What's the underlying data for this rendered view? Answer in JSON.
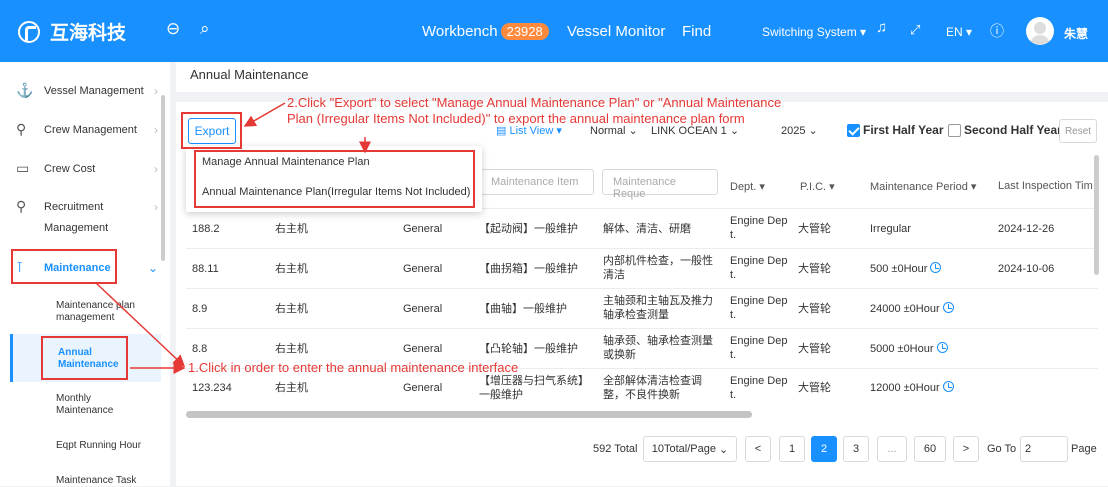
{
  "topbar": {
    "brand": "互海科技",
    "workbench": "Workbench",
    "workbench_count": "23928",
    "vessel_monitor": "Vessel Monitor",
    "find": "Find",
    "switching_system": "Switching System ▾",
    "lang": "EN ▾",
    "user": "朱慧"
  },
  "sidebar": {
    "items": [
      {
        "label": "Vessel Management"
      },
      {
        "label": "Crew Management"
      },
      {
        "label": "Crew Cost"
      },
      {
        "label": "Recruitment"
      },
      {
        "label2": "Management"
      },
      {
        "label": "Maintenance"
      }
    ],
    "sub": {
      "plan_mgmt_1": "Maintenance plan",
      "plan_mgmt_2": "management",
      "annual_1": "Annual",
      "annual_2": "Maintenance",
      "monthly_1": "Monthly",
      "monthly_2": "Maintenance",
      "eqpt": "Eqpt Running Hour",
      "task": "Maintenance Task"
    }
  },
  "page": {
    "title": "Annual Maintenance",
    "export": "Export",
    "list_view": "List View ▾",
    "normal": "Normal",
    "vessel": "LINK OCEAN 1",
    "year": "2025",
    "first_half": "First Half Year",
    "second_half": "Second Half Year",
    "reset": "Reset"
  },
  "dropdown": {
    "item1": "Manage Annual Maintenance Plan",
    "item2": "Annual Maintenance Plan(Irregular Items Not Included)"
  },
  "annotations": {
    "step2_line1": "2.Click \"Export\" to select \"Manage Annual Maintenance Plan\" or \"Annual Maintenance",
    "step2_line2": "Plan (Irregular Items Not Included)\" to export the annual maintenance plan form",
    "step1": "1.Click in order to enter the annual maintenance interface"
  },
  "table": {
    "filters": {
      "item": "Maintenance Item",
      "req": "Maintenance Reque"
    },
    "headers": {
      "dept": "Dept. ▾",
      "pic": "P.I.C. ▾",
      "period": "Maintenance Period ▾",
      "last": "Last Inspection Tim"
    },
    "rows": [
      {
        "code": "188.2",
        "equip": "右主机",
        "type": "General",
        "item": "【起动阀】一般维护",
        "req": "解体、清洁、研磨",
        "dept": "Engine Dep t.",
        "pic": "大管轮",
        "period": "Irregular",
        "last": "2024-12-26"
      },
      {
        "code": "88.11",
        "equip": "右主机",
        "type": "General",
        "item": "【曲拐箱】一般维护",
        "req": "内部机件检查，一般性清洁",
        "dept": "Engine Dep t.",
        "pic": "大管轮",
        "period": "500 ±0Hour",
        "last": "2024-10-06"
      },
      {
        "code": "8.9",
        "equip": "右主机",
        "type": "General",
        "item": "【曲轴】一般维护",
        "req": "主轴颈和主轴瓦及推力轴承检查测量",
        "dept": "Engine Dep t.",
        "pic": "大管轮",
        "period": "24000 ±0Hour",
        "last": ""
      },
      {
        "code": "8.8",
        "equip": "右主机",
        "type": "General",
        "item": "【凸轮轴】一般维护",
        "req": "轴承颈、轴承检查测量或换新",
        "dept": "Engine Dep t.",
        "pic": "大管轮",
        "period": "5000 ±0Hour",
        "last": ""
      },
      {
        "code": "123.234",
        "equip": "右主机",
        "type": "General",
        "item": "【增压器与扫气系统】一般维护",
        "req": "全部解体清洁检查调整，不良件换新",
        "dept": "Engine Dep t.",
        "pic": "大管轮",
        "period": "12000 ±0Hour",
        "last": ""
      }
    ]
  },
  "pagination": {
    "total": "592 Total",
    "per_page": "10Total/Page",
    "prev": "<",
    "p1": "1",
    "p2": "2",
    "p3": "3",
    "ellipsis": "...",
    "p60": "60",
    "next": ">",
    "goto": "Go To",
    "goto_value": "2",
    "page": "Page"
  }
}
